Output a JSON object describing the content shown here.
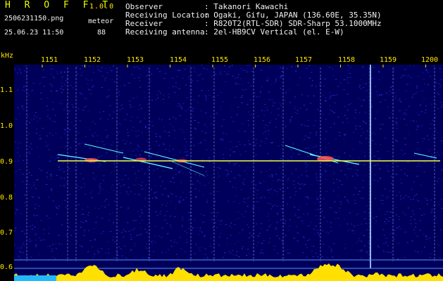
{
  "app": {
    "title": "H R O F F T",
    "version": "1.0.0"
  },
  "file": {
    "name": "2506231150.png",
    "event_type": "meteor",
    "datetime": "25.06.23 11:50",
    "count": "88"
  },
  "info": [
    {
      "label": "Observer",
      "value": ": Takanori Kawachi"
    },
    {
      "label": "Receiving Location",
      "value": ": Ogaki, Gifu, JAPAN (136.60E, 35.35N)"
    },
    {
      "label": "Receiver",
      "value": ": R820T2(RTL-SDR) SDR-Sharp 53.1000MHz"
    },
    {
      "label": "Receiving antenna",
      "value": ": 2el-HB9CV Vertical (el. E-W)"
    }
  ],
  "axis": {
    "unit": "kHz",
    "y_ticks": [
      "1.1",
      "1.0",
      "0.9",
      "0.8",
      "0.7",
      "0.6"
    ],
    "x_ticks": [
      "1151",
      "1152",
      "1153",
      "1154",
      "1155",
      "1156",
      "1157",
      "1158",
      "1159",
      "1200"
    ]
  },
  "colors": {
    "background": "#00005a",
    "noise": "#2a3cff",
    "carrier": "#f0ff40",
    "meteor": "#60ffff",
    "hot": "#ff5050",
    "level": "#ffe000",
    "text_yellow": "#ffe600"
  }
}
